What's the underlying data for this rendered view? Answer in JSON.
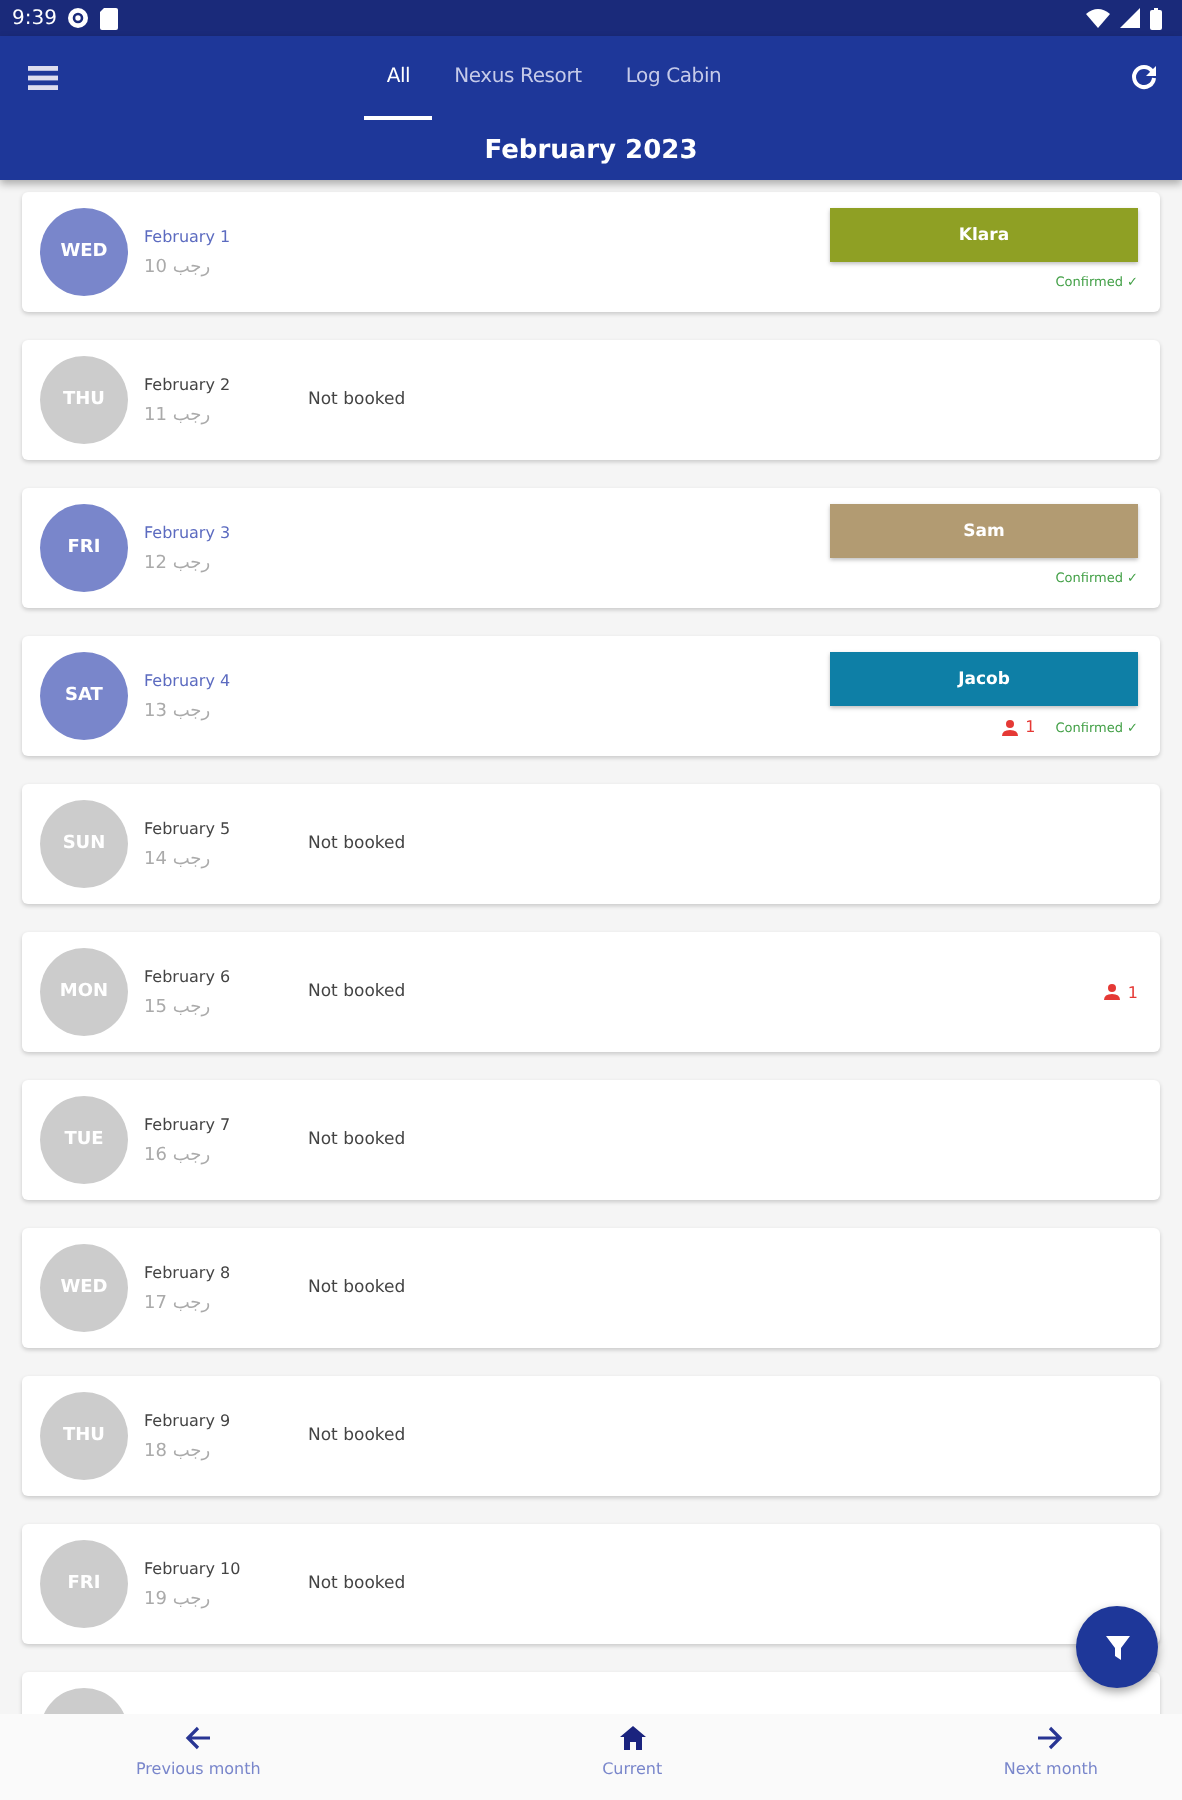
{
  "status_bar": {
    "time": "9:39"
  },
  "tabs": [
    {
      "label": "All",
      "selected": true
    },
    {
      "label": "Nexus Resort",
      "selected": false
    },
    {
      "label": "Log Cabin",
      "selected": false
    }
  ],
  "month_title": "February 2023",
  "days": [
    {
      "weekday": "WED",
      "booked": true,
      "date": "February 1",
      "hijri": "10 رجب",
      "booking": {
        "name": "Klara",
        "color": "#8fa024",
        "status": "Confirmed ✓"
      }
    },
    {
      "weekday": "THU",
      "booked": false,
      "date": "February 2",
      "hijri": "11 رجب",
      "note": "Not booked"
    },
    {
      "weekday": "FRI",
      "booked": true,
      "date": "February 3",
      "hijri": "12 رجب",
      "booking": {
        "name": "Sam",
        "color": "#b29b72",
        "status": "Confirmed ✓"
      }
    },
    {
      "weekday": "SAT",
      "booked": true,
      "date": "February 4",
      "hijri": "13 رجب",
      "booking": {
        "name": "Jacob",
        "color": "#0e7fa6",
        "status": "Confirmed ✓",
        "guests": "1"
      }
    },
    {
      "weekday": "SUN",
      "booked": false,
      "date": "February 5",
      "hijri": "14 رجب",
      "note": "Not booked"
    },
    {
      "weekday": "MON",
      "booked": false,
      "date": "February 6",
      "hijri": "15 رجب",
      "note": "Not booked",
      "guests": "1"
    },
    {
      "weekday": "TUE",
      "booked": false,
      "date": "February 7",
      "hijri": "16 رجب",
      "note": "Not booked"
    },
    {
      "weekday": "WED",
      "booked": false,
      "date": "February 8",
      "hijri": "17 رجب",
      "note": "Not booked"
    },
    {
      "weekday": "THU",
      "booked": false,
      "date": "February 9",
      "hijri": "18 رجب",
      "note": "Not booked"
    },
    {
      "weekday": "FRI",
      "booked": false,
      "date": "February 10",
      "hijri": "19 رجب",
      "note": "Not booked"
    }
  ],
  "bottom_nav": [
    {
      "label": "Previous month",
      "kind": "prev"
    },
    {
      "label": "Current",
      "kind": "home"
    },
    {
      "label": "Next month",
      "kind": "next"
    }
  ]
}
